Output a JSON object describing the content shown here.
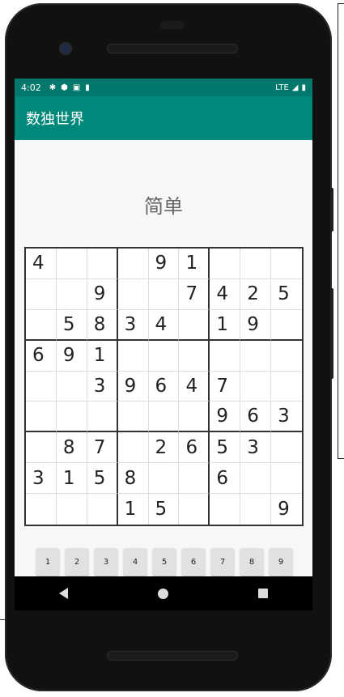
{
  "status": {
    "time": "4:02",
    "network": "LTE"
  },
  "app": {
    "title": "数独世界"
  },
  "game": {
    "difficulty": "简单",
    "grid": [
      [
        "4",
        "",
        "",
        "",
        "9",
        "1",
        "",
        "",
        ""
      ],
      [
        "",
        "",
        "9",
        "",
        "",
        "7",
        "4",
        "2",
        "5"
      ],
      [
        "",
        "5",
        "8",
        "3",
        "4",
        "",
        "1",
        "9",
        ""
      ],
      [
        "6",
        "9",
        "1",
        "",
        "",
        "",
        "",
        "",
        ""
      ],
      [
        "",
        "",
        "3",
        "9",
        "6",
        "4",
        "7",
        "",
        ""
      ],
      [
        "",
        "",
        "",
        "",
        "",
        "",
        "9",
        "6",
        "3"
      ],
      [
        "",
        "8",
        "7",
        "",
        "2",
        "6",
        "5",
        "3",
        ""
      ],
      [
        "3",
        "1",
        "5",
        "8",
        "",
        "",
        "6",
        "",
        ""
      ],
      [
        "",
        "",
        "",
        "1",
        "5",
        "",
        "",
        "",
        "9"
      ]
    ]
  },
  "numpad": {
    "keys": [
      "1",
      "2",
      "3",
      "4",
      "5",
      "6",
      "7",
      "8",
      "9"
    ]
  },
  "colors": {
    "status_bar": "#00786b",
    "app_bar": "#00897b",
    "background": "#f7f7f7"
  }
}
